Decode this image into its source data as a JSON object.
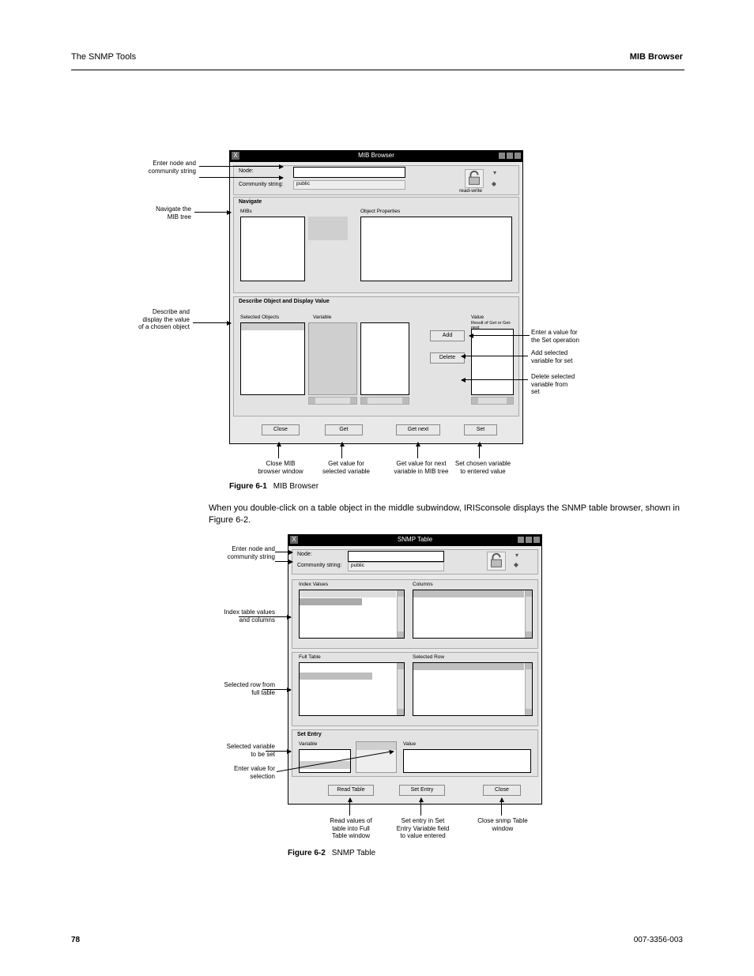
{
  "page": {
    "running_head_left": "The SNMP Tools",
    "running_head_right": "MIB Browser",
    "figure1_caption_label": "Figure 6-1",
    "figure1_caption_text": "MIB Browser",
    "figure2_caption_label": "Figure 6-2",
    "figure2_caption_text": "SNMP Table",
    "body_after_fig1": "When you double-click on a table object in the middle subwindow, IRISconsole displays the SNMP table browser, shown in Figure 6-2.",
    "footer_left": "78",
    "footer_right": "007-3356-003"
  },
  "fig1": {
    "window_title": "MIB Browser",
    "node_label": "Node:",
    "community_label": "Community string:",
    "community_value": "public",
    "navigate_label": "Navigate",
    "nav_left_header": "MIBs",
    "nav_right_header": "Object Properties",
    "sel_left_label": "Selected Objects",
    "sel_right_label": "Variable",
    "describe_label": "Describe Object and Display Value",
    "value_label": "Value",
    "value_subhdr": "Result of Get or Get-next",
    "btn_add": "Add",
    "btn_delete": "Delete",
    "btn_close": "Close",
    "btn_get": "Get",
    "btn_getnext": "Get next",
    "btn_set": "Set",
    "callouts": {
      "node": "Enter node and\ncommunity string",
      "nav": "Navigate the\nMIB tree",
      "desc": "Describe and\ndisplay the value\nof a chosen object",
      "value": "Enter a value for\nthe Set operation",
      "add": "Add selected\nvariable for set",
      "delete": "Delete selected\nvariable from\nset",
      "close": "Close MIB\nbrowser window",
      "get": "Get value for\nselected variable",
      "getnext": "Get value for next\nvariable in MIB tree",
      "set": "Set chosen variable\nto entered value"
    }
  },
  "fig2": {
    "window_title": "SNMP Table",
    "node_label": "Node:",
    "community_label": "Community string:",
    "community_value": "public",
    "index_label": "Index Values",
    "cols_label": "Columns",
    "full_label": "Full Table",
    "row_label": "Selected Row",
    "set_panel": "Set Entry",
    "var_label": "Variable",
    "val_label": "Value",
    "btn_read": "Read Table",
    "btn_set": "Set Entry",
    "btn_close": "Close",
    "callouts": {
      "node": "Enter node and\ncommunity string",
      "index": "Index table values\nand columns",
      "row": "Selected row from\nfull table",
      "var": "Selected variable\nto be set",
      "value": "Enter value for\nselection",
      "read": "Read values of\ntable into Full\nTable window",
      "set": "Set entry in Set\nEntry Variable field\nto value entered",
      "close": "Close snmp Table\nwindow"
    }
  }
}
